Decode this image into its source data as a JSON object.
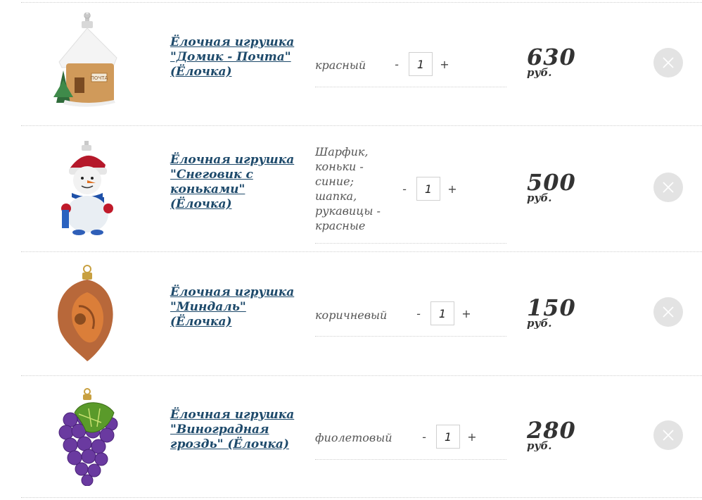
{
  "cart": {
    "currency": "руб.",
    "items": [
      {
        "title": "Ёлочная игрушка \"Домик - Почта\" (Ёлочка)",
        "variant": "красный",
        "quantity": "1",
        "price": "630",
        "image_icon": "house-ornament-icon"
      },
      {
        "title": "Ёлочная игрушка \"Снеговик с коньками\" (Ёлочка)",
        "variant": "Шарфик, коньки - синие; шапка, рукавицы - красные",
        "quantity": "1",
        "price": "500",
        "image_icon": "snowman-ornament-icon"
      },
      {
        "title": "Ёлочная игрушка \"Миндаль\" (Ёлочка)",
        "variant": "коричневый",
        "quantity": "1",
        "price": "150",
        "image_icon": "almond-ornament-icon"
      },
      {
        "title": "Ёлочная игрушка \"Виноградная гроздь\" (Ёлочка)",
        "variant": "фиолетовый",
        "quantity": "1",
        "price": "280",
        "image_icon": "grape-ornament-icon"
      }
    ],
    "qty_minus": "-",
    "qty_plus": "+",
    "colors": {
      "title_link": "#1e4a6b",
      "variant_text": "#555555",
      "price_text": "#333333",
      "remove_button": "#e3e3e3"
    }
  }
}
